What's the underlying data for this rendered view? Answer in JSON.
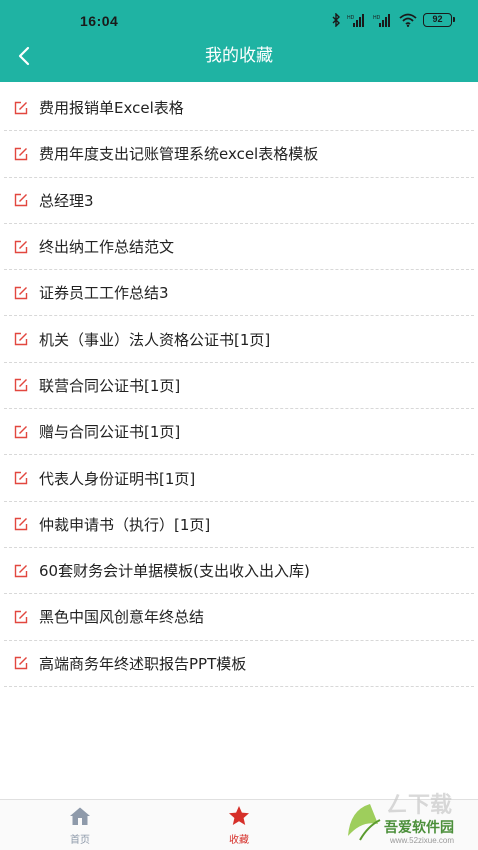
{
  "status_bar": {
    "time": "16:04",
    "battery": "92"
  },
  "header": {
    "title": "我的收藏",
    "back_icon": "chevron-left-icon",
    "background": "#1fb3a3"
  },
  "favorites": [
    {
      "label": "费用报销单Excel表格"
    },
    {
      "label": "费用年度支出记账管理系统excel表格模板"
    },
    {
      "label": "总经理3"
    },
    {
      "label": "终出纳工作总结范文"
    },
    {
      "label": "证券员工工作总结3"
    },
    {
      "label": "机关（事业）法人资格公证书[1页]"
    },
    {
      "label": "联营合同公证书[1页]"
    },
    {
      "label": "赠与合同公证书[1页]"
    },
    {
      "label": "代表人身份证明书[1页]"
    },
    {
      "label": "仲裁申请书（执行）[1页]"
    },
    {
      "label": "60套财务会计单据模板(支出收入出入库)"
    },
    {
      "label": "黑色中国风创意年终总结"
    },
    {
      "label": "高端商务年终述职报告PPT模板"
    }
  ],
  "item_icon": "edit-icon",
  "item_icon_color": "#e2473f",
  "tab_bar": {
    "tabs": [
      {
        "label": "首页",
        "icon": "home-icon",
        "active": false
      },
      {
        "label": "收藏",
        "icon": "star-icon",
        "active": true
      }
    ],
    "active_color": "#d6302a",
    "inactive_color": "#8e9aaa"
  },
  "watermark": {
    "text": "吾爱软件园",
    "url": "www.52zixue.com"
  }
}
